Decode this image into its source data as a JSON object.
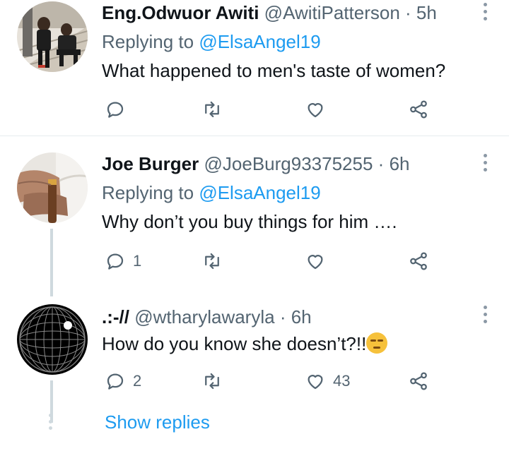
{
  "tweets": [
    {
      "name": "Eng.Odwuor Awiti",
      "handle": "@AwitiPatterson",
      "sep": "·",
      "time": "5h",
      "replying_prefix": "Replying to ",
      "replying_to": "@ElsaAngel19",
      "text": "What happened to men's taste of women?",
      "reply_count": "",
      "like_count": ""
    },
    {
      "name": "Joe Burger",
      "handle": "@JoeBurg93375255",
      "sep": "·",
      "time": "6h",
      "replying_prefix": "Replying to ",
      "replying_to": "@ElsaAngel19",
      "text": "Why don’t you buy things for him ….",
      "reply_count": "1",
      "like_count": ""
    },
    {
      "name": ".:-//",
      "handle": "@wtharylawaryla",
      "sep": "·",
      "time": "6h",
      "text": "How do you know she doesn’t?!!",
      "emoji": "unamused-face-icon",
      "reply_count": "2",
      "like_count": "43"
    }
  ],
  "show_replies": "Show replies",
  "colors": {
    "accent": "#1d9bf0",
    "secondary_text": "#536471",
    "thread_line": "#cfd9de"
  }
}
